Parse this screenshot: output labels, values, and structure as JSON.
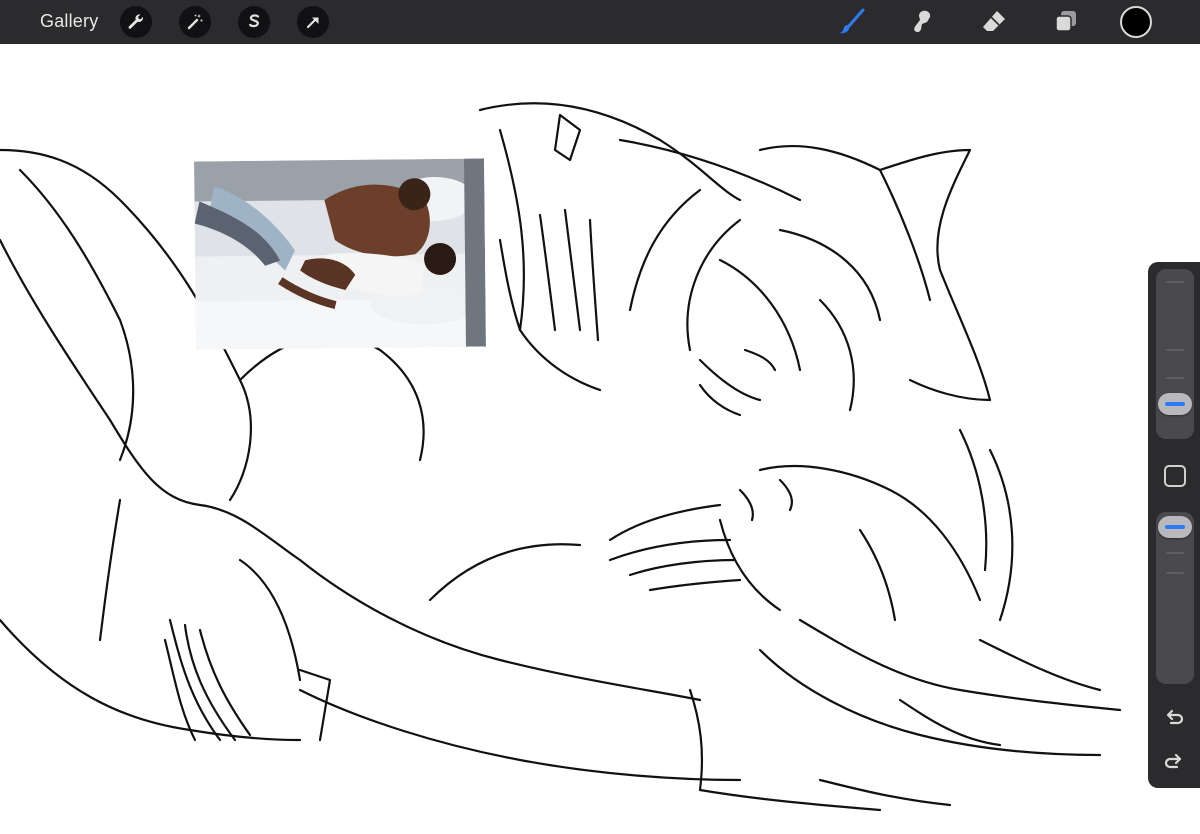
{
  "topbar": {
    "gallery_label": "Gallery",
    "left_tools": [
      {
        "name": "actions",
        "icon": "wrench-icon"
      },
      {
        "name": "adjustments",
        "icon": "magic-wand-icon"
      },
      {
        "name": "selection",
        "icon": "selection-s-icon"
      },
      {
        "name": "transform",
        "icon": "arrow-cursor-icon"
      }
    ],
    "right_tools": [
      {
        "name": "brush",
        "icon": "brush-icon",
        "active": true
      },
      {
        "name": "smudge",
        "icon": "smudge-icon",
        "active": false
      },
      {
        "name": "eraser",
        "icon": "eraser-icon",
        "active": false
      },
      {
        "name": "layers",
        "icon": "layers-icon",
        "active": false
      }
    ],
    "current_color": "#000000"
  },
  "colors": {
    "toolbar_bg": "#2b2b2d",
    "active_tool": "#2f7bf5",
    "icon": "#d9d9d9",
    "slider_accent": "#2f7bf5"
  },
  "canvas": {
    "background": "#ffffff",
    "reference_image": "reference-photo"
  },
  "sidebar": {
    "brush_size_level": 0.25,
    "opacity_level": 0.95,
    "modify_button": "square-icon",
    "undo_icon": "undo-icon",
    "redo_icon": "redo-icon"
  }
}
